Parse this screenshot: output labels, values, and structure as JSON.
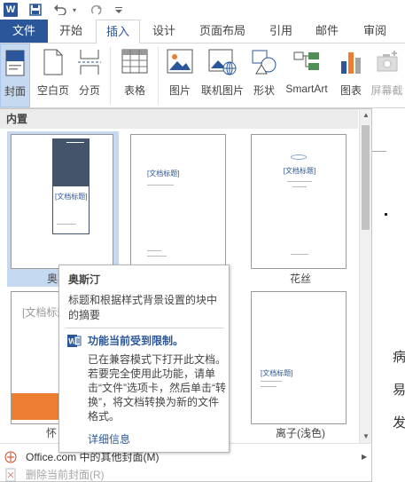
{
  "app_logo_letter": "W",
  "tabs": [
    {
      "label": "文件"
    },
    {
      "label": "开始"
    },
    {
      "label": "插入"
    },
    {
      "label": "设计"
    },
    {
      "label": "页面布局"
    },
    {
      "label": "引用"
    },
    {
      "label": "邮件"
    },
    {
      "label": "审阅"
    }
  ],
  "ribbon": {
    "cover": "封面",
    "blank_page": "空白页",
    "page_break": "分页",
    "table": "表格",
    "picture": "图片",
    "online_picture": "联机图片",
    "shapes": "形状",
    "smartart": "SmartArt",
    "chart": "图表",
    "screenshot": "屏幕截"
  },
  "gallery": {
    "header": "内置",
    "items": [
      {
        "caption": "奥斯汀",
        "placeholder": "[文档标题]"
      },
      {
        "caption": "",
        "placeholder": "[文档标题]"
      },
      {
        "caption": "花丝",
        "placeholder": "[文档标题]"
      },
      {
        "caption": "怀",
        "placeholder": "[文档标题]"
      },
      {
        "caption": "",
        "placeholder": ""
      },
      {
        "caption": "离子(浅色)",
        "placeholder": "[文档标题]"
      }
    ],
    "more_covers": "Office.com 中的其他封面(M)",
    "remove_cover": "删除当前封面(R)"
  },
  "tooltip": {
    "title": "奥斯汀",
    "description": "标题和根据样式背景设置的块中的摘要",
    "warning_title": "功能当前受到限制。",
    "warning_body": "已在兼容模式下打开此文档。若要完全使用此功能，请单击“文件”选项卡，然后单击“转换”，将文档转换为新的文件格式。",
    "link": "详细信息"
  },
  "document_chars": [
    "病",
    "易",
    "发"
  ],
  "colors": {
    "accent": "#2b579a",
    "selected": "#c5d9f1",
    "austin_block": "#44546a",
    "orange_band": "#ed7d31"
  }
}
